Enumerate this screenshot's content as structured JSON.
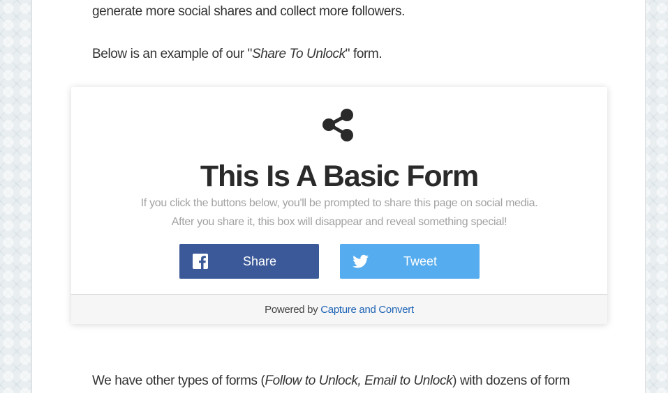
{
  "article": {
    "intro_line": "generate more social shares and collect more followers.",
    "example_before": "Below is an example of our \"",
    "example_emph": "Share To Unlock",
    "example_after": "\" form.",
    "other_before": "We have other types of forms (",
    "other_emph": "Follow to Unlock, Email to Unlock",
    "other_after": ") with dozens of form"
  },
  "unlock_form": {
    "icon": "share-icon",
    "title": "This Is A Basic Form",
    "subtitle_line1": "If you click the buttons below, you'll be prompted to share this page on social media.",
    "subtitle_line2": "After you share it, this box will disappear and reveal something special!",
    "buttons": [
      {
        "label": "Share",
        "icon": "facebook-icon",
        "color": "#3b5998"
      },
      {
        "label": "Tweet",
        "icon": "twitter-icon",
        "color": "#55acee"
      }
    ],
    "powered_by_prefix": "Powered by ",
    "powered_by_link": "Capture and Convert",
    "link_color": "#1e63b5"
  }
}
